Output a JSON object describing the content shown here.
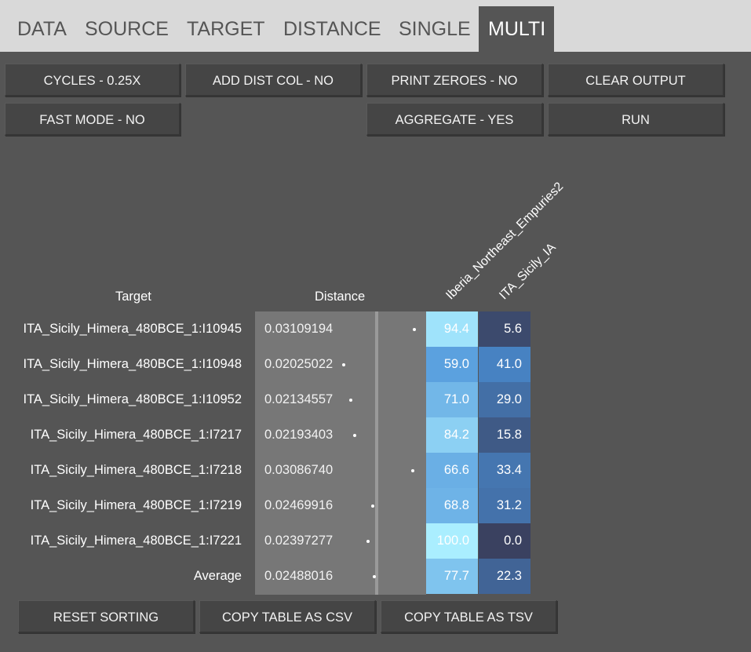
{
  "tabs": [
    {
      "label": "DATA",
      "active": false
    },
    {
      "label": "SOURCE",
      "active": false
    },
    {
      "label": "TARGET",
      "active": false
    },
    {
      "label": "DISTANCE",
      "active": false
    },
    {
      "label": "SINGLE",
      "active": false
    },
    {
      "label": "MULTI",
      "active": true
    }
  ],
  "buttons": {
    "cycles": "CYCLES - 0.25X",
    "add_dist_col": "ADD DIST COL - NO",
    "print_zeroes": "PRINT ZEROES - NO",
    "clear_output": "CLEAR OUTPUT",
    "fast_mode": "FAST MODE - NO",
    "aggregate": "AGGREGATE - YES",
    "run": "RUN",
    "reset_sorting": "RESET SORTING",
    "copy_csv": "COPY TABLE AS CSV",
    "copy_tsv": "COPY TABLE AS TSV"
  },
  "table": {
    "target_header": "Target",
    "distance_header": "Distance",
    "sources": [
      "Iberia_Northeast_Empuries2",
      "ITA_Sicily_IA"
    ],
    "rows": [
      {
        "target": "ITA_Sicily_Himera_480BCE_1:I10945",
        "distance": "0.03109194",
        "d": 0.03109194,
        "v1": "94.4",
        "v2": "5.6"
      },
      {
        "target": "ITA_Sicily_Himera_480BCE_1:I10948",
        "distance": "0.02025022",
        "d": 0.02025022,
        "v1": "59.0",
        "v2": "41.0"
      },
      {
        "target": "ITA_Sicily_Himera_480BCE_1:I10952",
        "distance": "0.02134557",
        "d": 0.02134557,
        "v1": "71.0",
        "v2": "29.0"
      },
      {
        "target": "ITA_Sicily_Himera_480BCE_1:I7217",
        "distance": "0.02193403",
        "d": 0.02193403,
        "v1": "84.2",
        "v2": "15.8"
      },
      {
        "target": "ITA_Sicily_Himera_480BCE_1:I7218",
        "distance": "0.03086740",
        "d": 0.0308674,
        "v1": "66.6",
        "v2": "33.4"
      },
      {
        "target": "ITA_Sicily_Himera_480BCE_1:I7219",
        "distance": "0.02469916",
        "d": 0.02469916,
        "v1": "68.8",
        "v2": "31.2"
      },
      {
        "target": "ITA_Sicily_Himera_480BCE_1:I7221",
        "distance": "0.02397277",
        "d": 0.02397277,
        "v1": "100.0",
        "v2": "0.0"
      }
    ],
    "average": {
      "target": "Average",
      "distance": "0.02488016",
      "d": 0.02488016,
      "v1": "77.7",
      "v2": "22.3"
    }
  },
  "colors": {
    "background": "#555555",
    "tabbar": "#d9d9d9",
    "distance_column": "#777777",
    "pct_high": "#aaeeff",
    "pct_low": "#3a4160"
  }
}
